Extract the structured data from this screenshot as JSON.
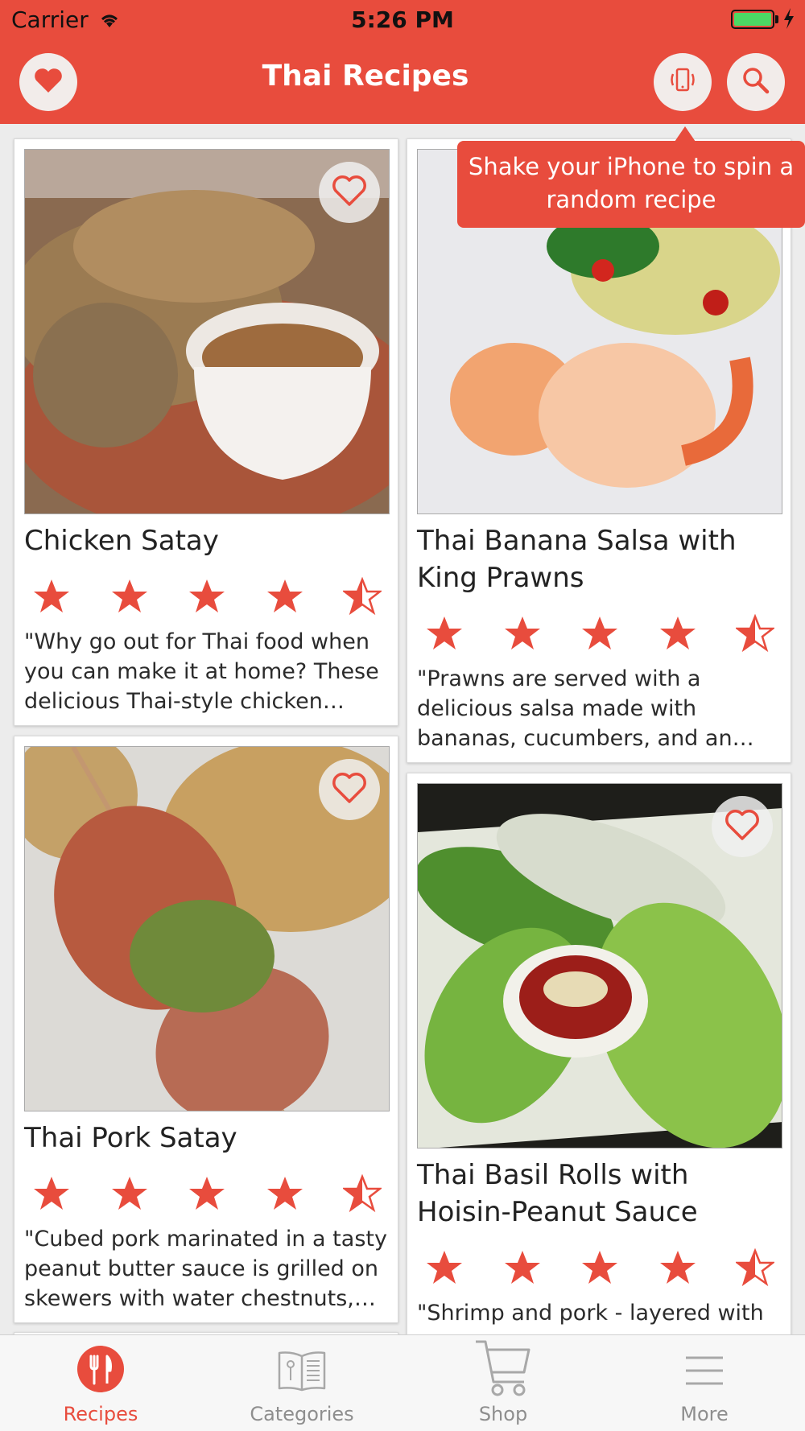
{
  "status_bar": {
    "carrier": "Carrier",
    "time": "5:26 PM"
  },
  "nav": {
    "title": "Thai Recipes",
    "left_icon": "heart-icon",
    "right_icons": [
      "shake-phone-icon",
      "search-icon"
    ]
  },
  "tooltip": {
    "text": "Shake your iPhone to spin a random recipe"
  },
  "recipes": [
    {
      "title": "Chicken Satay",
      "rating": 4.5,
      "description": "\"Why go out for Thai food when you can make it at home? These delicious Thai-style chicken satay…"
    },
    {
      "title": "Thai Banana Salsa with King Prawns",
      "rating": 4.5,
      "description": "\"Prawns are served with a delicious salsa made with bananas, cucumbers, and an exo…"
    },
    {
      "title": "Thai Pork Satay",
      "rating": 4.5,
      "description": "\"Cubed pork marinated in a tasty peanut butter sauce is grilled on skewers with water chestnuts, g…"
    },
    {
      "title": "Thai Basil Rolls with Hoisin-Peanut Sauce",
      "rating": 4.5,
      "description": "\"Shrimp and pork - layered with"
    }
  ],
  "tabbar": {
    "items": [
      {
        "label": "Recipes",
        "icon": "fork-knife-icon",
        "active": true
      },
      {
        "label": "Categories",
        "icon": "book-icon",
        "active": false
      },
      {
        "label": "Shop",
        "icon": "cart-icon",
        "active": false
      },
      {
        "label": "More",
        "icon": "menu-icon",
        "active": false
      }
    ]
  },
  "colors": {
    "accent": "#e84c3d",
    "tab_inactive": "#8e8e8e"
  }
}
